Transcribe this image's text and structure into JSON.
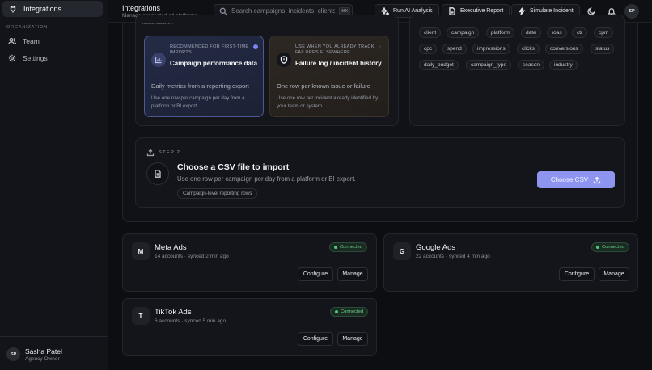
{
  "sidebar": {
    "active_item": {
      "label": "Integrations",
      "icon": "plug-icon"
    },
    "section_label": "ORGANIZATION",
    "items": [
      {
        "label": "Team",
        "icon": "users-icon"
      },
      {
        "label": "Settings",
        "icon": "gear-icon"
      }
    ],
    "user": {
      "initials": "SP",
      "name": "Sasha Patel",
      "role": "Agency Owner"
    }
  },
  "header": {
    "title": "Integrations",
    "subtitle": "Manage connected ad platforms",
    "search_placeholder": "Search campaigns, incidents, clients",
    "search_shortcut": "⌘K",
    "buttons": {
      "ai": "Run AI Analysis",
      "report": "Executive Report",
      "simulate": "Simulate Incident"
    },
    "avatar_initials": "SP"
  },
  "import": {
    "cut_text": "issue tracker.",
    "options": [
      {
        "kicker": "RECOMMENDED FOR FIRST-TIME IMPORTS",
        "title": "Campaign performance data",
        "description": "Daily metrics from a reporting export",
        "note": "Use one row per campaign per day from a platform or BI export.",
        "selected": true
      },
      {
        "kicker": "USE WHEN YOU ALREADY TRACK FAILURES ELSEWHERE",
        "title": "Failure log / incident history",
        "description": "One row per known issue or failure",
        "note": "Use one row per incident already identified by your team or system.",
        "selected": false
      }
    ],
    "columns": [
      "client",
      "campaign",
      "platform",
      "date",
      "roas",
      "ctr",
      "cpm",
      "cpc",
      "spend",
      "impressions",
      "clicks",
      "conversions",
      "status",
      "daily_budget",
      "campaign_type",
      "season",
      "industry"
    ],
    "step": {
      "label": "STEP 2",
      "title": "Choose a CSV file to import",
      "description": "Use one row per campaign per day from a platform or BI export.",
      "tag": "Campaign-level reporting rows",
      "button": "Choose CSV"
    }
  },
  "integrations": [
    {
      "logo": "M",
      "name": "Meta Ads",
      "meta": "14 accounts · synced 2 min ago",
      "status": "Connected",
      "configure": "Configure",
      "manage": "Manage"
    },
    {
      "logo": "G",
      "name": "Google Ads",
      "meta": "22 accounts · synced 4 min ago",
      "status": "Connected",
      "configure": "Configure",
      "manage": "Manage"
    },
    {
      "logo": "T",
      "name": "TikTok Ads",
      "meta": "6 accounts · synced 5 min ago",
      "status": "Connected",
      "configure": "Configure",
      "manage": "Manage"
    }
  ],
  "colors": {
    "accent": "#8d95f1",
    "connected": "#4ec97b",
    "background": "#0d0e12"
  }
}
